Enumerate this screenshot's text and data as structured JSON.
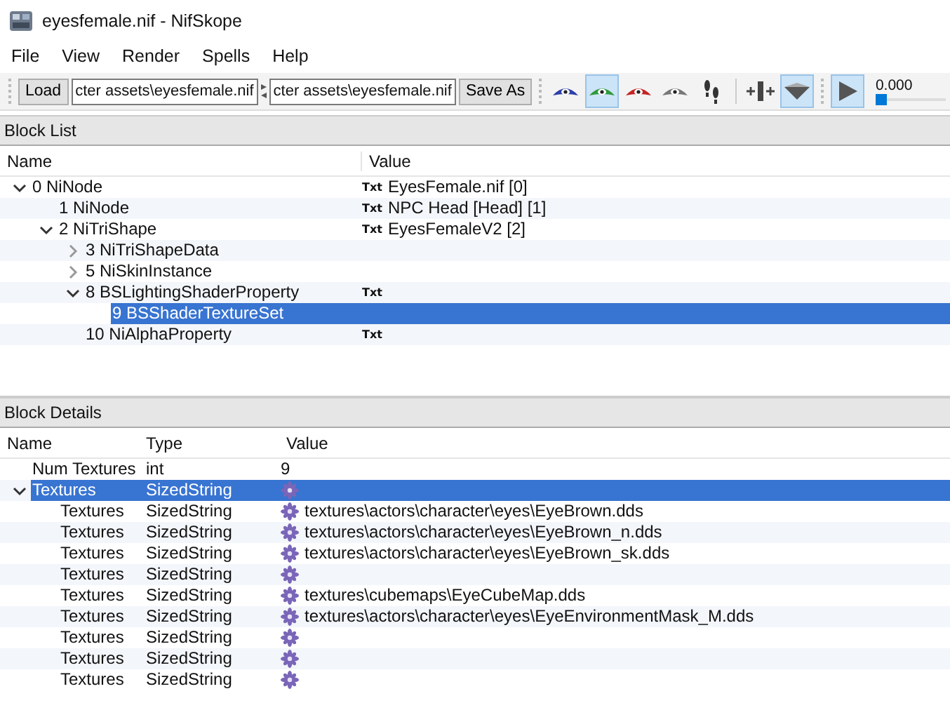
{
  "window": {
    "title": "eyesfemale.nif - NifSkope"
  },
  "menu": [
    "File",
    "View",
    "Render",
    "Spells",
    "Help"
  ],
  "toolbar": {
    "load_button": "Load",
    "path_fields": [
      {
        "value": "cter assets\\eyesfemale.nif"
      },
      {
        "value": "cter assets\\eyesfemale.nif"
      }
    ],
    "save_button": "Save As",
    "tool_groups": [
      {
        "tools": [
          {
            "kind": "eye",
            "color": "#2d3fa8",
            "pressed": false
          },
          {
            "kind": "eye",
            "color": "#2e9a3c",
            "pressed": true
          },
          {
            "kind": "eye",
            "color": "#c42424",
            "pressed": false
          },
          {
            "kind": "eye",
            "color": "#777777",
            "pressed": false
          },
          {
            "kind": "footprints",
            "pressed": false
          }
        ]
      },
      {
        "tools": [
          {
            "kind": "axes",
            "pressed": false
          },
          {
            "kind": "cone",
            "pressed": true
          }
        ]
      },
      {
        "tools": [
          {
            "kind": "play",
            "pressed": true
          }
        ]
      }
    ],
    "time": {
      "reading": "0.000",
      "level": 0.0
    }
  },
  "block_list": {
    "title": "Block List",
    "columns": [
      "Name",
      "Value"
    ],
    "nodes": [
      {
        "name": "0 NiNode",
        "expanded": true,
        "selected": false,
        "tag": "Txt",
        "value": "EyesFemale.nif [0]",
        "children": [
          {
            "name": "1 NiNode",
            "selected": false,
            "tag": "Txt",
            "value": "NPC Head [Head] [1]"
          },
          {
            "name": "2 NiTriShape",
            "expanded": true,
            "selected": false,
            "tag": "Txt",
            "value": "EyesFemaleV2 [2]",
            "children": [
              {
                "name": "3 NiTriShapeData",
                "expanded": false,
                "selected": false
              },
              {
                "name": "5 NiSkinInstance",
                "expanded": false,
                "selected": false
              },
              {
                "name": "8 BSLightingShaderProperty",
                "expanded": true,
                "selected": false,
                "tag": "Txt",
                "children": [
                  {
                    "name": "9 BSShaderTextureSet",
                    "selected": true
                  }
                ]
              },
              {
                "name": "10 NiAlphaProperty",
                "selected": false,
                "tag": "Txt"
              }
            ]
          }
        ]
      }
    ]
  },
  "block_details": {
    "title": "Block Details",
    "columns": [
      "Name",
      "Type",
      "Value"
    ],
    "rows": [
      {
        "name": "Num Textures",
        "type": "int",
        "kind": "plain",
        "value": "9",
        "selected": false
      },
      {
        "name": "Textures",
        "type": "SizedString",
        "kind": "string",
        "expanded": true,
        "selected": true,
        "children": [
          {
            "name": "Textures",
            "type": "SizedString",
            "kind": "string",
            "value": "textures\\actors\\character\\eyes\\EyeBrown.dds",
            "selected": false
          },
          {
            "name": "Textures",
            "type": "SizedString",
            "kind": "string",
            "value": "textures\\actors\\character\\eyes\\EyeBrown_n.dds",
            "selected": false
          },
          {
            "name": "Textures",
            "type": "SizedString",
            "kind": "string",
            "value": "textures\\actors\\character\\eyes\\EyeBrown_sk.dds",
            "selected": false
          },
          {
            "name": "Textures",
            "type": "SizedString",
            "kind": "string",
            "selected": false
          },
          {
            "name": "Textures",
            "type": "SizedString",
            "kind": "string",
            "value": "textures\\cubemaps\\EyeCubeMap.dds",
            "selected": false
          },
          {
            "name": "Textures",
            "type": "SizedString",
            "kind": "string",
            "value": "textures\\actors\\character\\eyes\\EyeEnvironmentMask_M.dds",
            "selected": false
          },
          {
            "name": "Textures",
            "type": "SizedString",
            "kind": "string",
            "selected": false
          },
          {
            "name": "Textures",
            "type": "SizedString",
            "kind": "string",
            "selected": false
          },
          {
            "name": "Textures",
            "type": "SizedString",
            "kind": "string",
            "selected": false
          }
        ]
      }
    ]
  }
}
